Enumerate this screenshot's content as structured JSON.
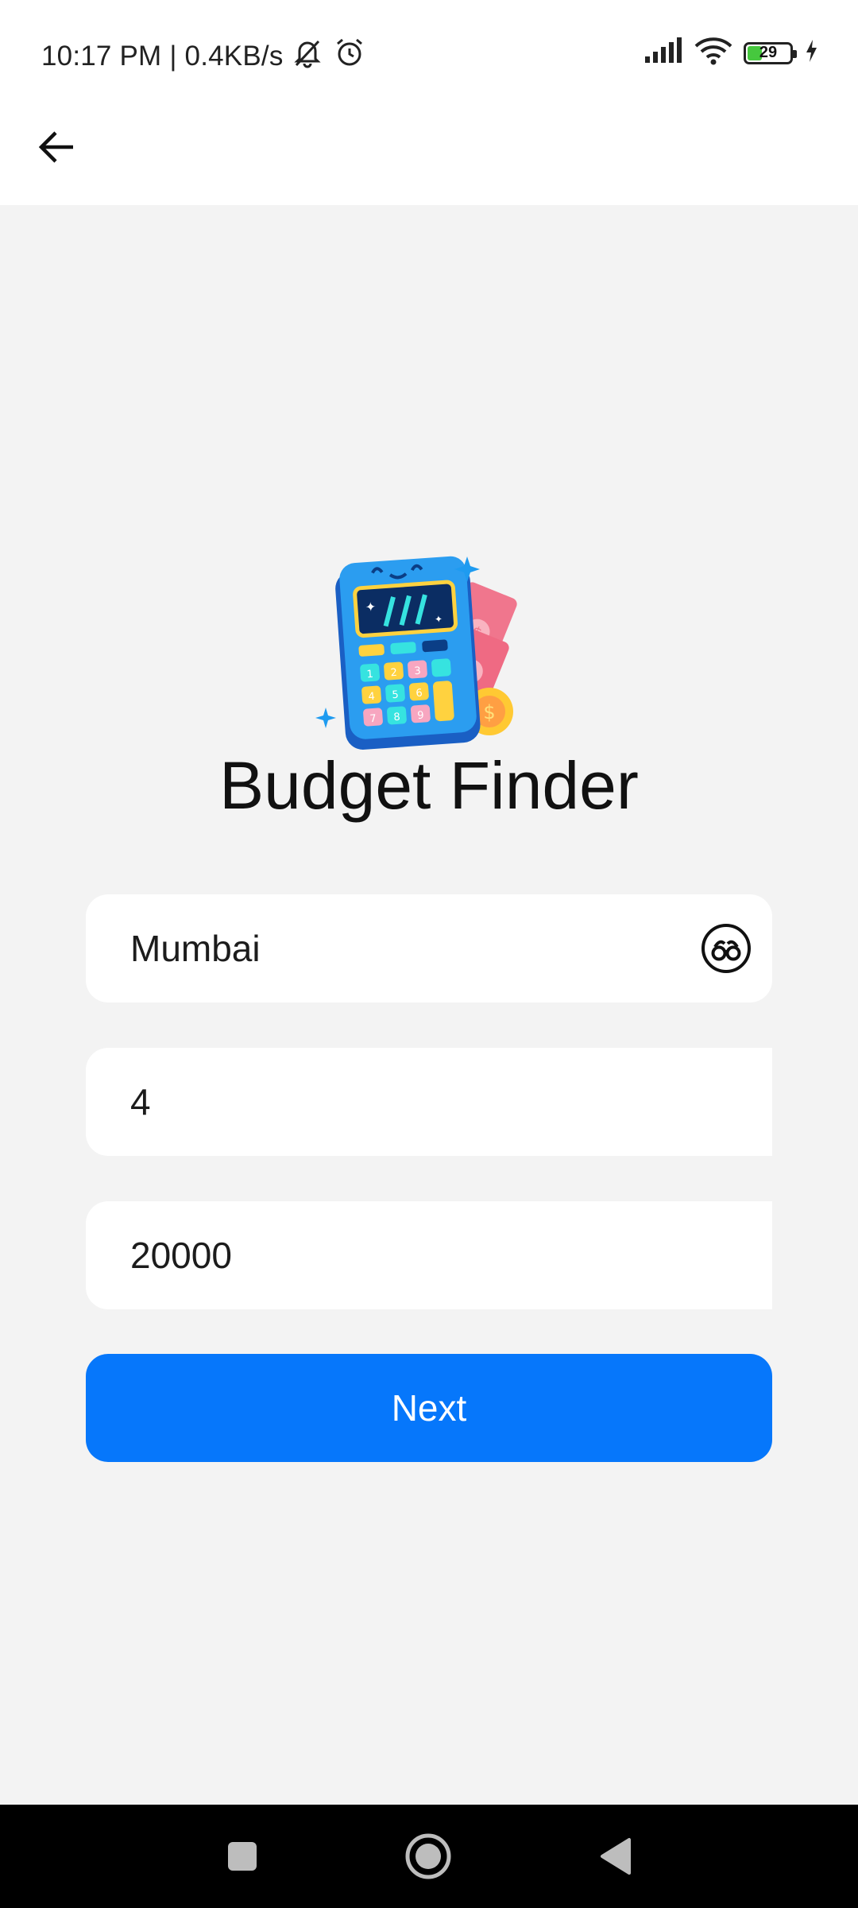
{
  "status_bar": {
    "time_speed": "10:17 PM | 0.4KB/s",
    "battery_level": "29",
    "icons": [
      "mute-bell-icon",
      "alarm-icon",
      "signal-icon",
      "wifi-icon",
      "battery-icon",
      "charging-icon"
    ]
  },
  "app_bar": {
    "back_icon": "back-arrow-icon"
  },
  "hero": {
    "illustration": "calculator-money-illustration"
  },
  "title": "Budget Finder",
  "form": {
    "city_value": "Mumbai",
    "city_action_icon": "binoculars-icon",
    "people_value": "4",
    "budget_value": "20000"
  },
  "next_label": "Next",
  "nav_bar": {
    "icons": [
      "recent-apps-icon",
      "home-icon",
      "back-triangle-icon"
    ]
  },
  "colors": {
    "primary": "#0677fb",
    "background": "#f3f3f3",
    "surface": "#ffffff"
  }
}
